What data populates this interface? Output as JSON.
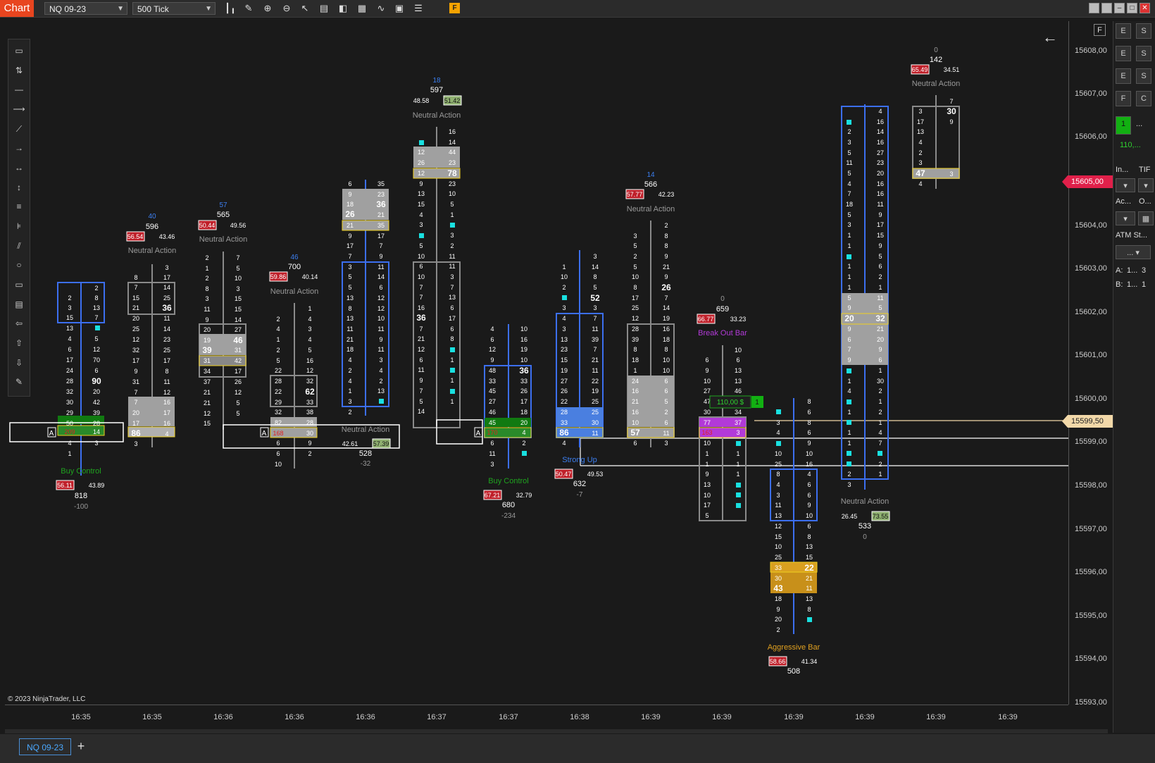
{
  "app": {
    "tab_label": "Chart",
    "instrument": "NQ 09-23",
    "interval": "500 Tick",
    "f_badge": "F",
    "copyright": "© 2023 NinjaTrader, LLC",
    "bottom_tab": "NQ 09-23",
    "add_tab": "+"
  },
  "toolbar_icons": [
    "bar-type-icon",
    "pencil-icon",
    "zoom-in-icon",
    "zoom-out-icon",
    "pointer-icon",
    "data-box-icon",
    "properties-icon",
    "templates-icon",
    "indicators-icon",
    "strategies-icon",
    "list-icon"
  ],
  "draw_tools": [
    "ruler-icon",
    "risk-reward-icon",
    "line-icon",
    "ray-icon",
    "extended-line-icon",
    "arrow-line-icon",
    "horizontal-line-icon",
    "vertical-line-icon",
    "fib-retracement-icon",
    "fib-extension-icon",
    "channel-icon",
    "ellipse-icon",
    "rectangle-icon",
    "region-icon",
    "arrow-left-icon",
    "arrow-up-icon",
    "arrow-down-icon",
    "pencil-icon"
  ],
  "price_axis": {
    "labels": [
      "15608,00",
      "15607,00",
      "15606,00",
      "15605,00",
      "15604,00",
      "15603,00",
      "15602,00",
      "15601,00",
      "15600,00",
      "15599,00",
      "15598,00",
      "15597,00",
      "15596,00",
      "15595,00",
      "15594,00",
      "15593,00"
    ],
    "current_price_tag": "15605,00",
    "position_tag": "15599,50"
  },
  "time_axis": [
    "16:35",
    "16:35",
    "16:36",
    "16:36",
    "16:36",
    "16:37",
    "16:37",
    "16:38",
    "16:39",
    "16:39",
    "16:39",
    "16:39",
    "16:39",
    "16:39"
  ],
  "order_line": {
    "pnl": "110,00 $",
    "qty": "1"
  },
  "right_panel": {
    "qty_value": "1",
    "qty_extra": "...",
    "pnl_value": "110,...",
    "instrument_label": "In...",
    "tif_label": "TIF",
    "account_label": "Ac...",
    "order_label": "O...",
    "atm_label": "ATM St...",
    "atm_value": "...",
    "ask_label": "A:",
    "ask_value": "1...",
    "ask_qty": "3",
    "bid_label": "B:",
    "bid_value": "1...",
    "bid_qty": "1"
  },
  "bars": [
    {
      "label": "Buy Control",
      "delta_pct_sell": "56.11",
      "delta_pct_buy": "43.89",
      "volume": "818",
      "delta": "-100",
      "bar_delta": ""
    },
    {
      "label": "Neutral Action",
      "delta_pct_sell": "56.54",
      "delta_pct_buy": "43.46",
      "volume": "596",
      "delta": "40"
    },
    {
      "label": "Neutral Action",
      "delta_pct_sell": "50.44",
      "delta_pct_buy": "49.56",
      "volume": "565",
      "delta": "57"
    },
    {
      "label": "Neutral Action",
      "delta_pct_sell": "59.86",
      "delta_pct_buy": "40.14",
      "volume": "700",
      "delta": "46"
    },
    {
      "label": "Neutral Action",
      "delta_pct_sell": "42.61",
      "delta_pct_buy": "57.39",
      "volume": "528",
      "delta": "-32"
    },
    {
      "label": "Neutral Action",
      "delta_pct_sell": "48.58",
      "delta_pct_buy": "51.42",
      "volume": "597",
      "delta": "18"
    },
    {
      "label": "Buy Control",
      "delta_pct_sell": "67.21",
      "delta_pct_buy": "32.79",
      "volume": "680",
      "delta": "-234"
    },
    {
      "label": "Strong Up",
      "delta_pct_sell": "50.47",
      "delta_pct_buy": "49.53",
      "volume": "632",
      "delta": "-7"
    },
    {
      "label": "Neutral Action",
      "delta_pct_sell": "57.77",
      "delta_pct_buy": "42.23",
      "volume": "566",
      "delta": "14"
    },
    {
      "label": "Break Out Bar",
      "delta_pct_sell": "66.77",
      "delta_pct_buy": "33.23",
      "volume": "659",
      "delta": "0"
    },
    {
      "label": "Aggressive Bar",
      "delta_pct_sell": "58.66",
      "delta_pct_buy": "41.34",
      "volume": "508",
      "delta": ""
    },
    {
      "label": "Neutral Action",
      "delta_pct_sell": "26.45",
      "delta_pct_buy": "73.55",
      "volume": "533",
      "delta": "0"
    },
    {
      "label": "Neutral Action",
      "delta_pct_sell": "65.49",
      "delta_pct_buy": "34.51",
      "volume": "142",
      "delta": "0"
    }
  ],
  "colors": {
    "accent": "#e8451f",
    "box_blue": "#3c6ff0",
    "box_gray": "#8a8a8a",
    "label_green": "#1fa31f",
    "label_gray": "#9a9a9a",
    "label_purple": "#b23ad8",
    "label_orange": "#e0a020",
    "label_blue": "#3c7ff0",
    "red_badge": "#c0202a",
    "green_badge": "#8fb070",
    "cyan": "#19e0e0",
    "price_tag_red": "#e0204a",
    "position_tag": "#f2d8a8"
  }
}
